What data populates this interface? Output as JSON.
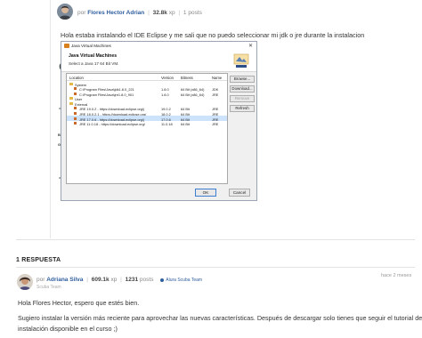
{
  "question": {
    "author": {
      "prefix": "por",
      "name": "Flores Hector Adrian",
      "points": "32.8k",
      "points_unit": "xp",
      "posts": "1",
      "posts_unit": "posts"
    },
    "text": "Hola estaba instalando el IDE Eclipse y me sali que no puedo seleccionar mi jdk o jre durante la instalacion"
  },
  "dialog": {
    "title": "Java Virtual Machines",
    "heading": "Java Virtual Machines",
    "subheading": "Select a Java 17 64 Bit VM.",
    "columns": {
      "location": "Location",
      "version": "Version",
      "bitness": "Bitness",
      "name": "Name"
    },
    "rows": [
      {
        "indent": 0,
        "type": "group",
        "location": "System",
        "version": "",
        "bitness": "",
        "name": "",
        "selected": false
      },
      {
        "indent": 1,
        "type": "jre",
        "location": "C:\\Program Files\\Java\\jdk1.8.0_221",
        "version": "1.8.0",
        "bitness": "64 Bit (x86_64)",
        "name": "JDK",
        "selected": false
      },
      {
        "indent": 1,
        "type": "jre",
        "location": "C:\\Program Files\\Java\\jre1.8.0_901",
        "version": "1.8.0",
        "bitness": "64 Bit (x86_64)",
        "name": "JRE",
        "selected": false
      },
      {
        "indent": 0,
        "type": "group",
        "location": "User",
        "version": "",
        "bitness": "",
        "name": "",
        "selected": false
      },
      {
        "indent": 0,
        "type": "group",
        "location": "External",
        "version": "",
        "bitness": "",
        "name": "",
        "selected": false
      },
      {
        "indent": 1,
        "type": "jre",
        "location": "JRE 19.0.2 - https://download.eclipse.org/j",
        "version": "19.0.2",
        "bitness": "64 Bit",
        "name": "JRE",
        "selected": false
      },
      {
        "indent": 1,
        "type": "jre",
        "location": "JRE 18.0.2.1 - https://download.eclipse.org/",
        "version": "18.0.2",
        "bitness": "64 Bit",
        "name": "JRE",
        "selected": false
      },
      {
        "indent": 1,
        "type": "jre",
        "location": "JRE 17.0.6 - https://download.eclipse.org/j",
        "version": "17.0.6",
        "bitness": "64 Bit",
        "name": "JRE",
        "selected": true
      },
      {
        "indent": 1,
        "type": "jre",
        "location": "JRE 11.0.18 - https://download.eclipse.org/",
        "version": "11.0.18",
        "bitness": "64 Bit",
        "name": "JRE",
        "selected": false
      }
    ],
    "buttons": {
      "browse": "Browse...",
      "download": "Download...",
      "remove": "Remove",
      "refresh": "Refresh",
      "ok": "OK",
      "cancel": "Cancel"
    },
    "peek": {
      "e": "e",
      "o1": "o",
      "o2": "o",
      "bs": "Bs",
      "go": "Go"
    }
  },
  "responses": {
    "title": "1 RESPUESTA"
  },
  "answer": {
    "author": {
      "prefix": "por",
      "name": "Adriana Silva",
      "points": "609.1k",
      "points_unit": "xp",
      "posts": "1231",
      "posts_unit": "posts",
      "badge": "Alura Scuba Team",
      "role": "Scuba Team"
    },
    "date": "hace 2 meses",
    "lines": [
      "Hola Flores Hector, espero que estés bien.",
      "Sugiero instalar la versión más reciente para aprovechar las nuevas características. Después de descargar solo tienes que seguir el tutorial de",
      "instalación disponible en el curso ;)"
    ]
  },
  "colors": {
    "link": "#2f5e9e",
    "selection": "#cde3fb",
    "folder": "#e6b84a"
  }
}
